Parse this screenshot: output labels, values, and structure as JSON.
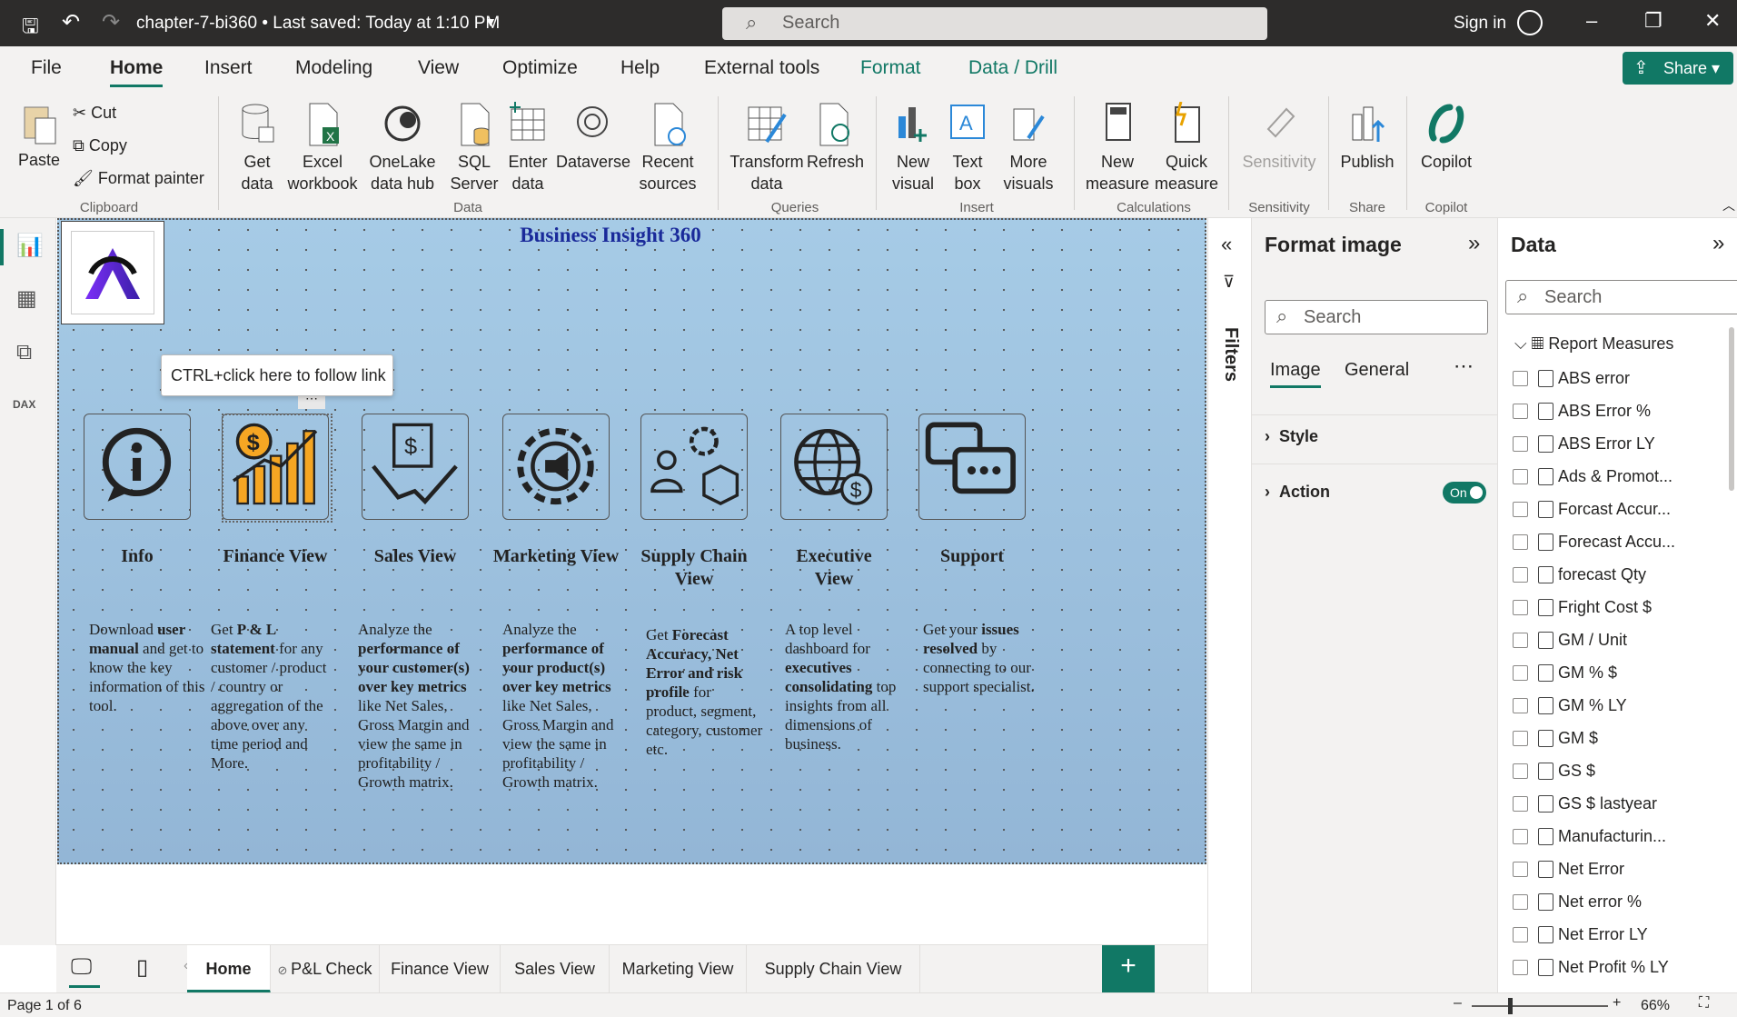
{
  "titlebar": {
    "title": "chapter-7-bi360 • Last saved: Today at 1:10 PM",
    "search_placeholder": "Search",
    "sign_in": "Sign in"
  },
  "menu": {
    "tabs": [
      "File",
      "Home",
      "Insert",
      "Modeling",
      "View",
      "Optimize",
      "Help",
      "External tools",
      "Format",
      "Data / Drill"
    ],
    "share": "Share"
  },
  "ribbon": {
    "clipboard": {
      "paste": "Paste",
      "cut": "Cut",
      "copy": "Copy",
      "format_painter": "Format painter",
      "group": "Clipboard"
    },
    "data": {
      "get_data": "Get data",
      "excel": "Excel workbook",
      "onelake": "OneLake data hub",
      "sql": "SQL Server",
      "enter": "Enter data",
      "dataverse": "Dataverse",
      "recent": "Recent sources",
      "group": "Data"
    },
    "queries": {
      "transform": "Transform data",
      "refresh": "Refresh",
      "group": "Queries"
    },
    "insert": {
      "new_visual": "New visual",
      "text_box": "Text box",
      "more_visuals": "More visuals",
      "group": "Insert"
    },
    "calculations": {
      "new_measure": "New measure",
      "quick_measure": "Quick measure",
      "group": "Calculations"
    },
    "sensitivity": {
      "label": "Sensitivity",
      "group": "Sensitivity"
    },
    "share": {
      "publish": "Publish",
      "group": "Share"
    },
    "copilot": {
      "label": "Copilot",
      "group": "Copilot"
    }
  },
  "canvas": {
    "title": "Business Insight 360",
    "tooltip": "CTRL+click here to follow link",
    "tiles": [
      {
        "title": "Info",
        "desc": [
          [
            "Download ",
            0
          ],
          [
            "user manual",
            1
          ],
          [
            " and get to know the key information of this tool.",
            0
          ]
        ]
      },
      {
        "title": "Finance View",
        "desc": [
          [
            "Get ",
            0
          ],
          [
            "P & L statement",
            1
          ],
          [
            " for any customer / product / country or aggregation of the above over any time period and More.",
            0
          ]
        ]
      },
      {
        "title": "Sales View",
        "desc": [
          [
            "Analyze the ",
            0
          ],
          [
            "performance of your customer(s) over key metrics",
            1
          ],
          [
            " like Net Sales, Gross Margin and view the same in profitability / Growth matrix.",
            0
          ]
        ]
      },
      {
        "title": "Marketing View",
        "desc": [
          [
            "Analyze the ",
            0
          ],
          [
            "performance of your product(s) over key metrics",
            1
          ],
          [
            " like Net Sales, Gross Margin and view the same in profitability / Growth matrix.",
            0
          ]
        ]
      },
      {
        "title": "Supply Chain View",
        "desc": [
          [
            "Get ",
            0
          ],
          [
            "Forecast Accuracy, Net Error and risk profile",
            1
          ],
          [
            " for product, segment, category, customer etc.",
            0
          ]
        ]
      },
      {
        "title": "Executive View",
        "desc": [
          [
            "A top level dashboard for ",
            0
          ],
          [
            "executives consolidating",
            1
          ],
          [
            " top insights from all dimensions of business.",
            0
          ]
        ]
      },
      {
        "title": "Support",
        "desc": [
          [
            "Get your ",
            0
          ],
          [
            "issues resolved",
            1
          ],
          [
            " by connecting to our support specialist.",
            0
          ]
        ]
      }
    ]
  },
  "filters": {
    "label": "Filters"
  },
  "format_pane": {
    "title": "Format image",
    "search_placeholder": "Search",
    "tabs": [
      "Image",
      "General"
    ],
    "sections": [
      "Style",
      "Action"
    ],
    "action_toggle": "On"
  },
  "data_pane": {
    "title": "Data",
    "search_placeholder": "Search",
    "table": "Report Measures",
    "fields": [
      "ABS error",
      "ABS Error %",
      "ABS Error LY",
      "Ads & Promot...",
      "Forcast Accur...",
      "Forecast Accu...",
      "forecast Qty",
      "Fright Cost $",
      "GM / Unit",
      "GM % $",
      "GM % LY",
      "GM $",
      "GS $",
      "GS $ lastyear",
      "Manufacturin...",
      "Net Error",
      "Net error %",
      "Net Error LY",
      "Net Profit % LY"
    ]
  },
  "page_tabs": [
    "Home",
    "P&L Check",
    "Finance View",
    "Sales View",
    "Marketing View",
    "Supply Chain View"
  ],
  "status": {
    "page": "Page 1 of 6",
    "zoom": "66%"
  },
  "colors": {
    "accent": "#117865",
    "canvas_bg": "#a3c8e3",
    "title": "#1a2a9a"
  }
}
